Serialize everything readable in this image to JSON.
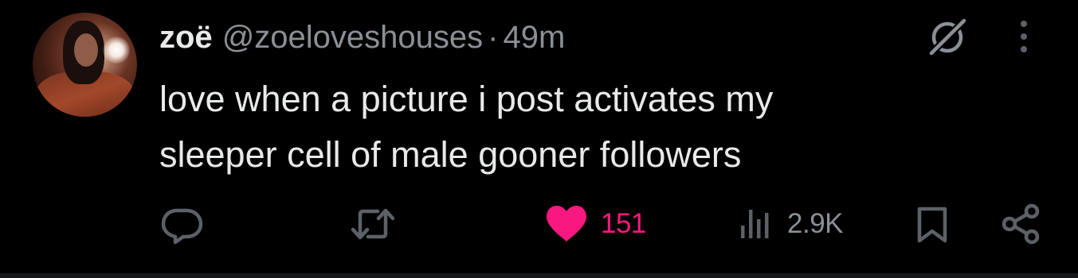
{
  "tweet": {
    "author": {
      "display_name": "zoë",
      "handle": "@zoeloveshouses",
      "avatar_icon": "profile-photo-avatar"
    },
    "separator": "·",
    "timestamp": "49m",
    "text_lines": [
      "love when a picture i post activates my",
      "sleeper cell of male gooner followers"
    ],
    "actions": {
      "reply": {
        "icon": "reply-bubble-icon"
      },
      "retweet": {
        "icon": "retweet-arrows-icon"
      },
      "like": {
        "icon": "heart-filled-icon",
        "count": "151",
        "liked": true
      },
      "views": {
        "icon": "bar-chart-icon",
        "count": "2.9K"
      },
      "bookmark": {
        "icon": "bookmark-icon"
      },
      "share": {
        "icon": "share-nodes-icon"
      }
    },
    "top_right": {
      "grok": {
        "icon": "grok-slash-circle-icon"
      },
      "more": {
        "icon": "more-vertical-icon"
      }
    }
  },
  "colors": {
    "background": "#000000",
    "primary_text": "#e7e9ea",
    "secondary_text": "#8b9096",
    "icon_gray": "#5c6167",
    "like_pink": "#f91880",
    "border": "#16181a"
  }
}
